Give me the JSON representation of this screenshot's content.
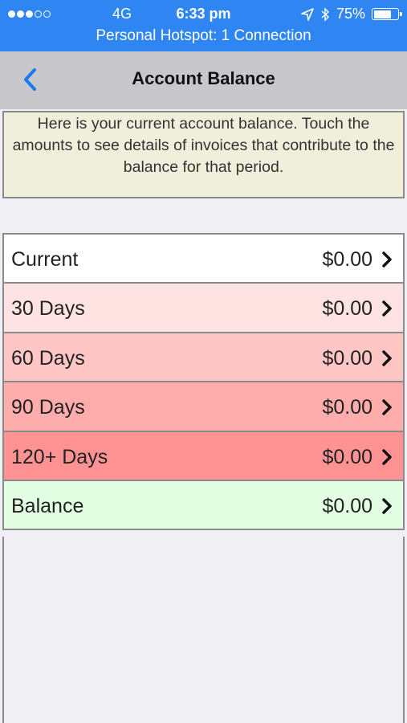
{
  "status_bar": {
    "carrier": "4G",
    "time": "6:33 pm",
    "battery": "75%",
    "battery_level": 0.75,
    "hotspot": "Personal Hotspot: 1 Connection"
  },
  "nav": {
    "title": "Account Balance",
    "back_icon": "chevron-left-icon"
  },
  "info_text": "Here is your current account balance.  Touch the amounts to see details of invoices that contribute to the balance for that period.",
  "rows": [
    {
      "label": "Current",
      "amount": "$0.00",
      "color": "#ffffff"
    },
    {
      "label": "30 Days",
      "amount": "$0.00",
      "color": "#ffe3e3"
    },
    {
      "label": "60 Days",
      "amount": "$0.00",
      "color": "#ffc6c6"
    },
    {
      "label": "90 Days",
      "amount": "$0.00",
      "color": "#ffacac"
    },
    {
      "label": "120+ Days",
      "amount": "$0.00",
      "color": "#ff9393"
    },
    {
      "label": "Balance",
      "amount": "$0.00",
      "color": "#e3ffe3"
    }
  ],
  "colors": {
    "status_bar": "#2f86f3",
    "nav_bar": "#c8c7cc",
    "accent": "#1a7cf5",
    "info_background": "#efefdb"
  }
}
